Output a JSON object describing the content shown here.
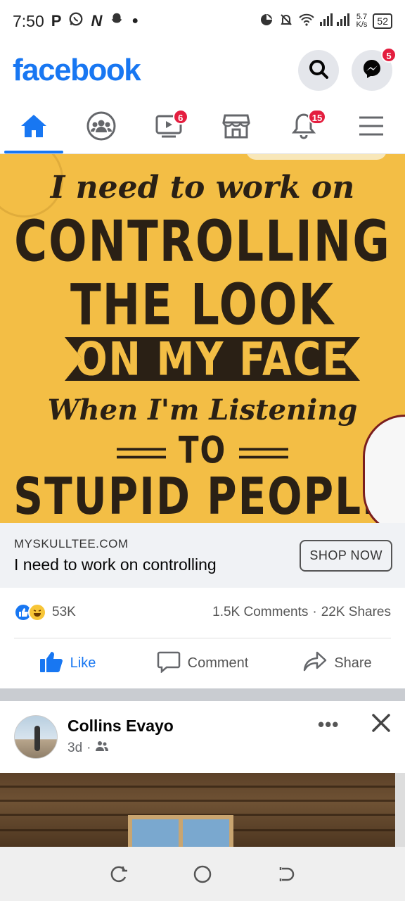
{
  "status_bar": {
    "time": "7:50",
    "left_icons": [
      "P",
      "N"
    ],
    "speed_value": "5.7",
    "speed_unit": "K/s",
    "battery": "52"
  },
  "header": {
    "logo": "facebook",
    "messenger_badge": "5"
  },
  "nav": {
    "tabs": [
      {
        "name": "home",
        "badge": ""
      },
      {
        "name": "groups",
        "badge": ""
      },
      {
        "name": "watch",
        "badge": "6"
      },
      {
        "name": "marketplace",
        "badge": ""
      },
      {
        "name": "notifications",
        "badge": "15"
      },
      {
        "name": "menu",
        "badge": ""
      }
    ]
  },
  "post": {
    "image_text": {
      "line1": "I need to work on",
      "line2": "CONTROLLING",
      "line3": "THE LOOK",
      "line4": "ON MY FACE",
      "line5": "When I'm Listening",
      "line6": "TO",
      "line7": "STUPID PEOPLE"
    },
    "link": {
      "domain": "MYSKULLTEE.COM",
      "title": "I need to work on controlling",
      "cta": "SHOP NOW"
    },
    "reactions_count": "53K",
    "comments": "1.5K Comments",
    "shares": "22K Shares",
    "separator": "·",
    "actions": {
      "like": "Like",
      "comment": "Comment",
      "share": "Share"
    }
  },
  "post2": {
    "author": "Collins Evayo",
    "time": "3d",
    "separator": "·"
  },
  "colors": {
    "brand": "#1877f2",
    "badge": "#e41e3f",
    "poster_yellow": "#f3be45"
  }
}
